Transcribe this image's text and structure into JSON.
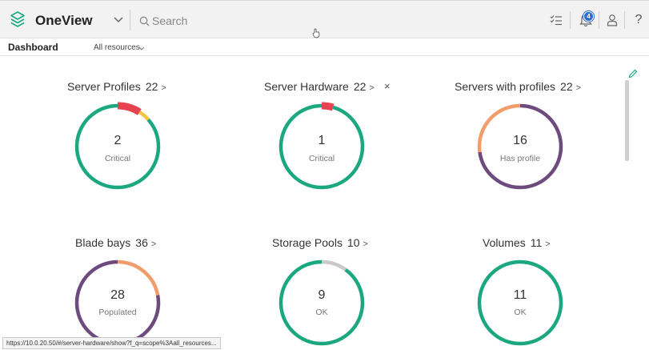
{
  "app": {
    "title": "OneView"
  },
  "search": {
    "placeholder": "Search"
  },
  "notifications": {
    "badge_count": "4"
  },
  "help": {
    "label": "?"
  },
  "subnav": {
    "dashboard": "Dashboard",
    "scope": "All resources"
  },
  "colors": {
    "ok": "#1ba881",
    "critical": "#e8414f",
    "warning": "#f6c443",
    "orange": "#f39c6b",
    "purple": "#6e4b7e",
    "gray": "#c9c9c9"
  },
  "cards": [
    {
      "title": "Server Profiles",
      "count": "22",
      "arrow": ">",
      "value": "2",
      "label": "Critical",
      "segments": [
        {
          "status": "critical",
          "fraction": 0.09
        },
        {
          "status": "warning",
          "fraction": 0.045
        },
        {
          "status": "ok",
          "fraction": 0.865
        }
      ]
    },
    {
      "title": "Server Hardware",
      "count": "22",
      "arrow": ">",
      "value": "1",
      "label": "Critical",
      "close": "×",
      "segments": [
        {
          "status": "critical",
          "fraction": 0.045
        },
        {
          "status": "ok",
          "fraction": 0.955
        }
      ]
    },
    {
      "title": "Servers with profiles",
      "count": "22",
      "arrow": ">",
      "value": "16",
      "label": "Has profile",
      "segments": [
        {
          "status": "purple",
          "fraction": 0.727
        },
        {
          "status": "orange",
          "fraction": 0.273
        }
      ]
    },
    {
      "title": "Blade bays",
      "count": "36",
      "arrow": ">",
      "value": "28",
      "label": "Populated",
      "segments": [
        {
          "status": "orange",
          "fraction": 0.22
        },
        {
          "status": "purple",
          "fraction": 0.78
        }
      ]
    },
    {
      "title": "Storage Pools",
      "count": "10",
      "arrow": ">",
      "value": "9",
      "label": "OK",
      "segments": [
        {
          "status": "gray",
          "fraction": 0.1
        },
        {
          "status": "ok",
          "fraction": 0.9
        }
      ]
    },
    {
      "title": "Volumes",
      "count": "11",
      "arrow": ">",
      "value": "11",
      "label": "OK",
      "segments": [
        {
          "status": "ok",
          "fraction": 1.0
        }
      ]
    }
  ],
  "status_bar": {
    "url": "https://10.0.20.50/#/server-hardware/show?f_q=scope%3Aall_resources..."
  }
}
